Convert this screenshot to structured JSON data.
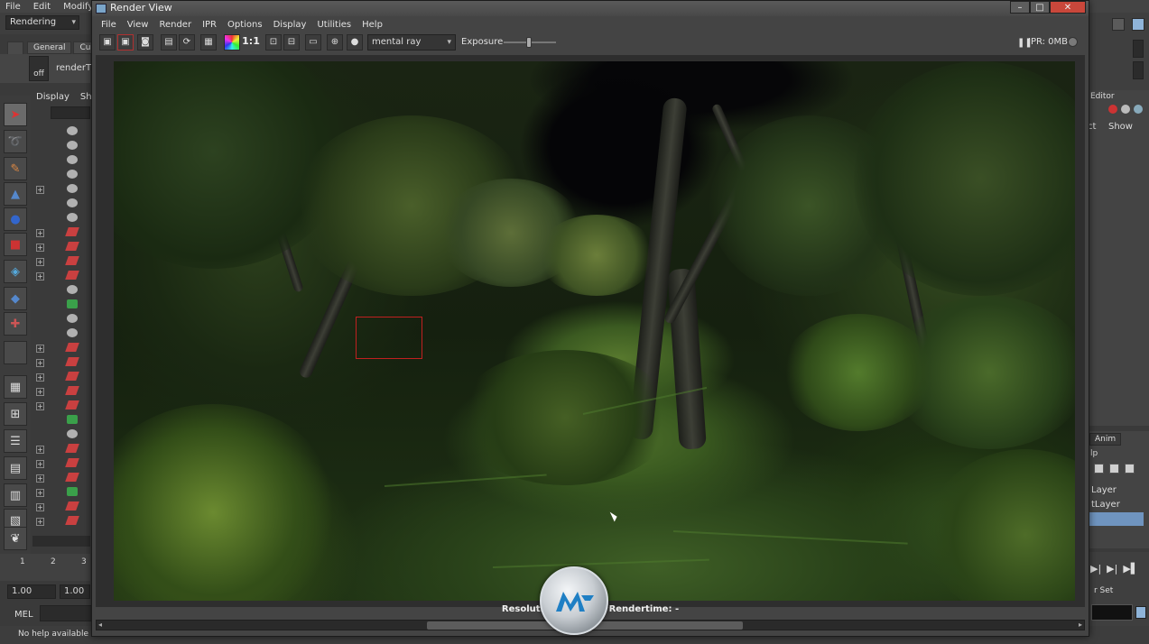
{
  "maya": {
    "menu": [
      "File",
      "Edit",
      "Modify"
    ],
    "menuset": "Rendering",
    "shelf_tabs": [
      "General",
      "Cu"
    ],
    "render_thumb_toggle": "off",
    "render_thumb_label": "renderTh",
    "outliner_tabs": [
      "Display",
      "Sho"
    ],
    "time_ticks": [
      "1",
      "2",
      "3"
    ],
    "range_start": "1.00",
    "range_end": "1.00",
    "mel_label": "MEL",
    "help_text": "No help available for"
  },
  "right_panel": {
    "attr_editor_title": "Editor",
    "attr_select": "ct",
    "attr_show": "Show",
    "layer_tab": "Anim",
    "layer_help": "lp",
    "layers": [
      "Layer",
      "tLayer",
      ""
    ],
    "character_set": "r Set"
  },
  "render_view": {
    "title": "Render View",
    "menu": [
      "File",
      "View",
      "Render",
      "IPR",
      "Options",
      "Display",
      "Utilities",
      "Help"
    ],
    "one_to_one": "1:1",
    "renderer": "mental ray",
    "exposure_label": "Exposure",
    "exposure_value": 0.0,
    "ipr_status": "IPR: 0MB",
    "status_line": "Resolution  ·  Re...ere  Rendertime: -",
    "colors": {
      "close_button": "#c9473b",
      "region_box": "#c02020",
      "selected_layer": "#6f94bf"
    }
  },
  "icons": {
    "close": "close-icon",
    "minimize": "minimize-icon",
    "maximize": "maximize-icon"
  }
}
